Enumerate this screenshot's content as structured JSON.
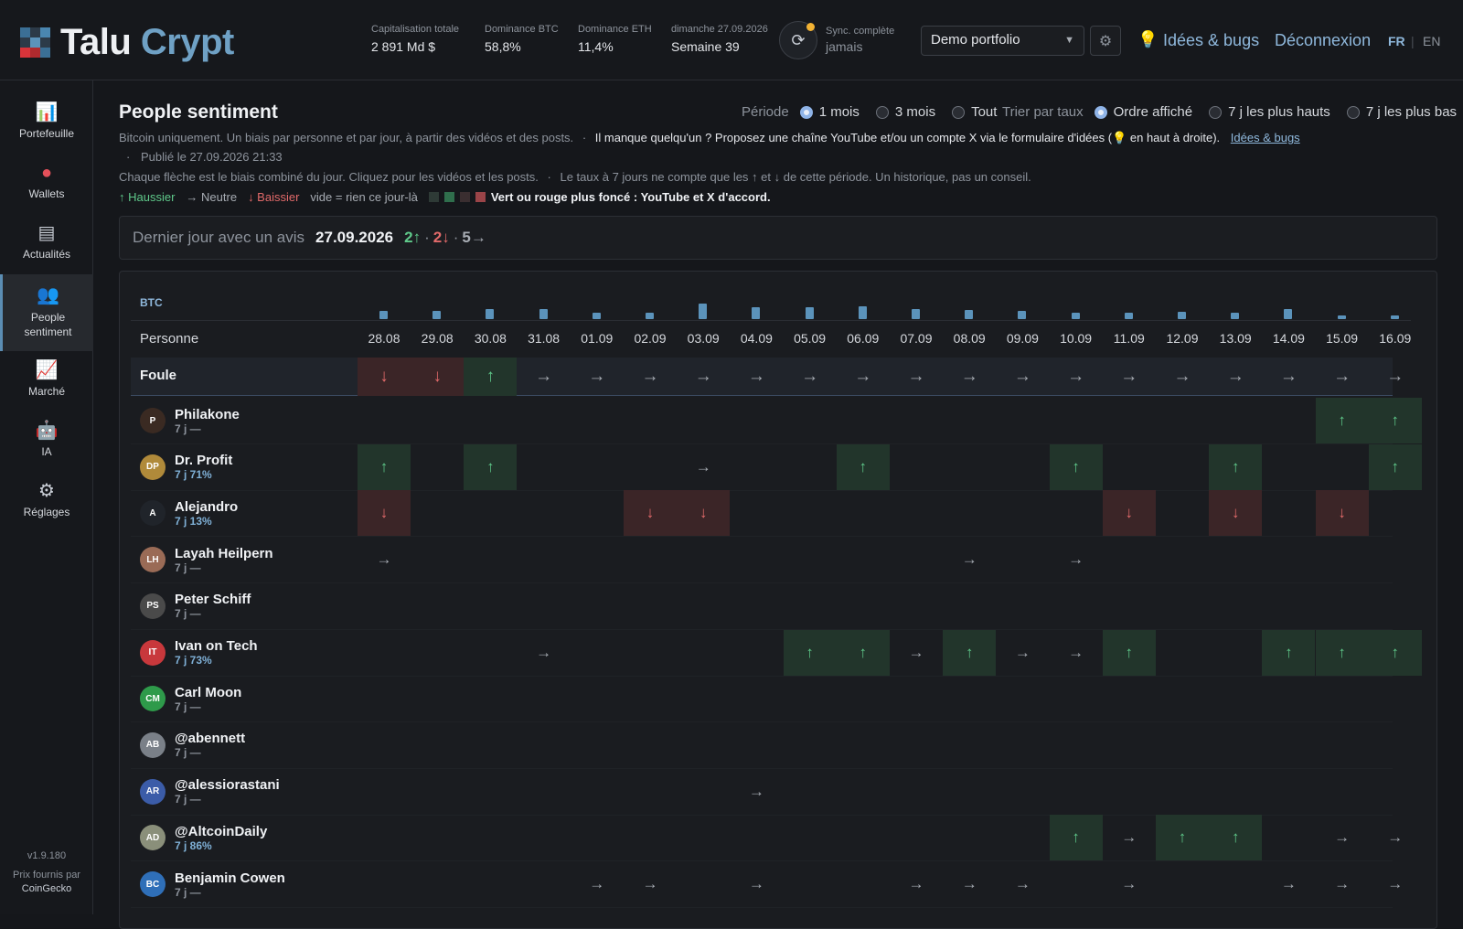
{
  "brand": {
    "word1": "Talu",
    "word2": "Crypt"
  },
  "stats": [
    {
      "label": "Capitalisation totale",
      "value": "2 891 Md $"
    },
    {
      "label": "Dominance BTC",
      "value": "58,8%"
    },
    {
      "label": "Dominance ETH",
      "value": "11,4%"
    },
    {
      "label": "dimanche 27.09.2026",
      "value": "Semaine 39"
    }
  ],
  "sync": {
    "label": "Sync. complète",
    "value": "jamais"
  },
  "portfolio": {
    "selected": "Demo portfolio"
  },
  "header_links": {
    "ideas": "Idées & bugs",
    "logout": "Déconnexion"
  },
  "lang": {
    "fr": "FR",
    "sep": "|",
    "en": "EN"
  },
  "sidebar": {
    "items": [
      {
        "label": "Portefeuille",
        "icon": "chart-icon"
      },
      {
        "label": "Wallets",
        "icon": "wallet-icon"
      },
      {
        "label": "Actualités",
        "icon": "news-icon"
      },
      {
        "label": "People sentiment",
        "icon": "people-icon",
        "active": true
      },
      {
        "label": "Marché",
        "icon": "market-icon"
      },
      {
        "label": "IA",
        "icon": "robot-icon"
      },
      {
        "label": "Réglages",
        "icon": "gear-icon"
      }
    ],
    "version": "v1.9.180",
    "prices_line1": "Prix fournis par",
    "prices_line2": "CoinGecko"
  },
  "page": {
    "title": "People sentiment",
    "period_label": "Période",
    "period_options": [
      "1 mois",
      "3 mois",
      "Tout"
    ],
    "period_selected": 0,
    "sort_label": "Trier par taux",
    "sort_options": [
      "Ordre affiché",
      "7 j les plus hauts",
      "7 j les plus bas"
    ],
    "sort_selected": 0,
    "desc1": "Bitcoin uniquement. Un biais par personne et par jour, à partir des vidéos et des posts.",
    "desc1_dot": "·",
    "desc1_w": "Il manque quelqu'un ? Proposez une chaîne YouTube et/ou un compte X via le formulaire d'idées (",
    "desc1_w2": " en haut à droite).",
    "desc1_link": "Idées & bugs",
    "published_dot": "·",
    "published": "Publié le 27.09.2026 21:33",
    "desc2": "Chaque flèche est le biais combiné du jour. Cliquez pour les vidéos et les posts.",
    "desc2_dot": "·",
    "desc2b": "Le taux à 7 jours ne compte que les ↑ et ↓ de cette période. Un historique, pas un conseil.",
    "legend": {
      "up": "↑ Haussier",
      "neutral": "→ Neutre",
      "down": "↓ Baissier",
      "empty": "vide = rien ce jour-là",
      "strong": "Vert ou rouge plus foncé : YouTube et X d'accord."
    },
    "last_day": {
      "label": "Dernier jour avec un avis",
      "date": "27.09.2026",
      "up": "2↑",
      "dot1": "·",
      "down": "2↓",
      "dot2": "·",
      "neutral": "5→"
    }
  },
  "grid": {
    "btc_label": "BTC",
    "person_header": "Personne",
    "dates": [
      "28.08",
      "29.08",
      "30.08",
      "31.08",
      "01.09",
      "02.09",
      "03.09",
      "04.09",
      "05.09",
      "06.09",
      "07.09",
      "08.09",
      "09.09",
      "10.09",
      "11.09",
      "12.09",
      "13.09",
      "14.09",
      "15.09",
      "16.09"
    ],
    "btc_bars": [
      0.4,
      0.42,
      0.48,
      0.5,
      0.32,
      0.3,
      0.75,
      0.6,
      0.6,
      0.65,
      0.5,
      0.46,
      0.42,
      0.3,
      0.34,
      0.36,
      0.3,
      0.5,
      0.18,
      0.17
    ],
    "crowd": {
      "name": "Foule",
      "cells": [
        "d",
        "d",
        "u",
        "n",
        "n",
        "n",
        "n",
        "n",
        "n",
        "n",
        "n",
        "n",
        "n",
        "n",
        "n",
        "n",
        "n",
        "n",
        "n",
        "n"
      ]
    },
    "people": [
      {
        "name": "Philakone",
        "rate": "7 j —",
        "hi": false,
        "av": "#3a2a22",
        "init": "P",
        "cells": [
          "",
          "",
          "",
          "",
          "",
          "",
          "",
          "",
          "",
          "",
          "",
          "",
          "",
          "",
          "",
          "",
          "",
          "",
          "u",
          "u"
        ]
      },
      {
        "name": "Dr. Profit",
        "rate": "7 j 71%",
        "hi": true,
        "av": "#b08a3a",
        "init": "DP",
        "cells": [
          "u",
          "",
          "u",
          "",
          "",
          "",
          "n",
          "",
          "",
          "u",
          "",
          "",
          "",
          "u",
          "",
          "",
          "u",
          "",
          "",
          "u"
        ]
      },
      {
        "name": "Alejandro",
        "rate": "7 j 13%",
        "hi": true,
        "av": "#20242a",
        "init": "A",
        "cells": [
          "d",
          "",
          "",
          "",
          "",
          "d",
          "d",
          "",
          "",
          "",
          "",
          "",
          "",
          "",
          "d",
          "",
          "d",
          "",
          "d",
          ""
        ]
      },
      {
        "name": "Layah Heilpern",
        "rate": "7 j —",
        "hi": false,
        "av": "#9a6b56",
        "init": "LH",
        "cells": [
          "n",
          "",
          "",
          "",
          "",
          "",
          "",
          "",
          "",
          "",
          "",
          "n",
          "",
          "n",
          "",
          "",
          "",
          "",
          "",
          ""
        ]
      },
      {
        "name": "Peter Schiff",
        "rate": "7 j —",
        "hi": false,
        "av": "#4a4a4a",
        "init": "PS",
        "cells": [
          "",
          "",
          "",
          "",
          "",
          "",
          "",
          "",
          "",
          "",
          "",
          "",
          "",
          "",
          "",
          "",
          "",
          "",
          "",
          ""
        ]
      },
      {
        "name": "Ivan on Tech",
        "rate": "7 j 73%",
        "hi": true,
        "av": "#c8383c",
        "init": "IT",
        "cells": [
          "",
          "",
          "",
          "n",
          "",
          "",
          "",
          "",
          "u",
          "u",
          "n",
          "u",
          "n",
          "n",
          "u",
          "",
          "",
          "u",
          "u",
          "u"
        ]
      },
      {
        "name": "Carl Moon",
        "rate": "7 j —",
        "hi": false,
        "av": "#2e9a4a",
        "init": "CM",
        "cells": [
          "",
          "",
          "",
          "",
          "",
          "",
          "",
          "",
          "",
          "",
          "",
          "",
          "",
          "",
          "",
          "",
          "",
          "",
          "",
          ""
        ]
      },
      {
        "name": "@abennett",
        "rate": "7 j —",
        "hi": false,
        "av": "#7a8088",
        "init": "AB",
        "cells": [
          "",
          "",
          "",
          "",
          "",
          "",
          "",
          "",
          "",
          "",
          "",
          "",
          "",
          "",
          "",
          "",
          "",
          "",
          "",
          ""
        ]
      },
      {
        "name": "@alessiorastani",
        "rate": "7 j —",
        "hi": false,
        "av": "#3b5ca8",
        "init": "AR",
        "cells": [
          "",
          "",
          "",
          "",
          "",
          "",
          "",
          "n",
          "",
          "",
          "",
          "",
          "",
          "",
          "",
          "",
          "",
          "",
          "",
          ""
        ]
      },
      {
        "name": "@AltcoinDaily",
        "rate": "7 j 86%",
        "hi": true,
        "av": "#8a8f7a",
        "init": "AD",
        "cells": [
          "",
          "",
          "",
          "",
          "",
          "",
          "",
          "",
          "",
          "",
          "",
          "",
          "",
          "u",
          "n",
          "u",
          "u",
          "",
          "n",
          "n"
        ]
      },
      {
        "name": "Benjamin Cowen",
        "rate": "7 j —",
        "hi": false,
        "av": "#2f6fb8",
        "init": "BC",
        "cells": [
          "",
          "",
          "",
          "",
          "n",
          "n",
          "",
          "n",
          "",
          "",
          "n",
          "n",
          "n",
          "",
          "n",
          "",
          "",
          "n",
          "n",
          "n"
        ]
      }
    ]
  }
}
